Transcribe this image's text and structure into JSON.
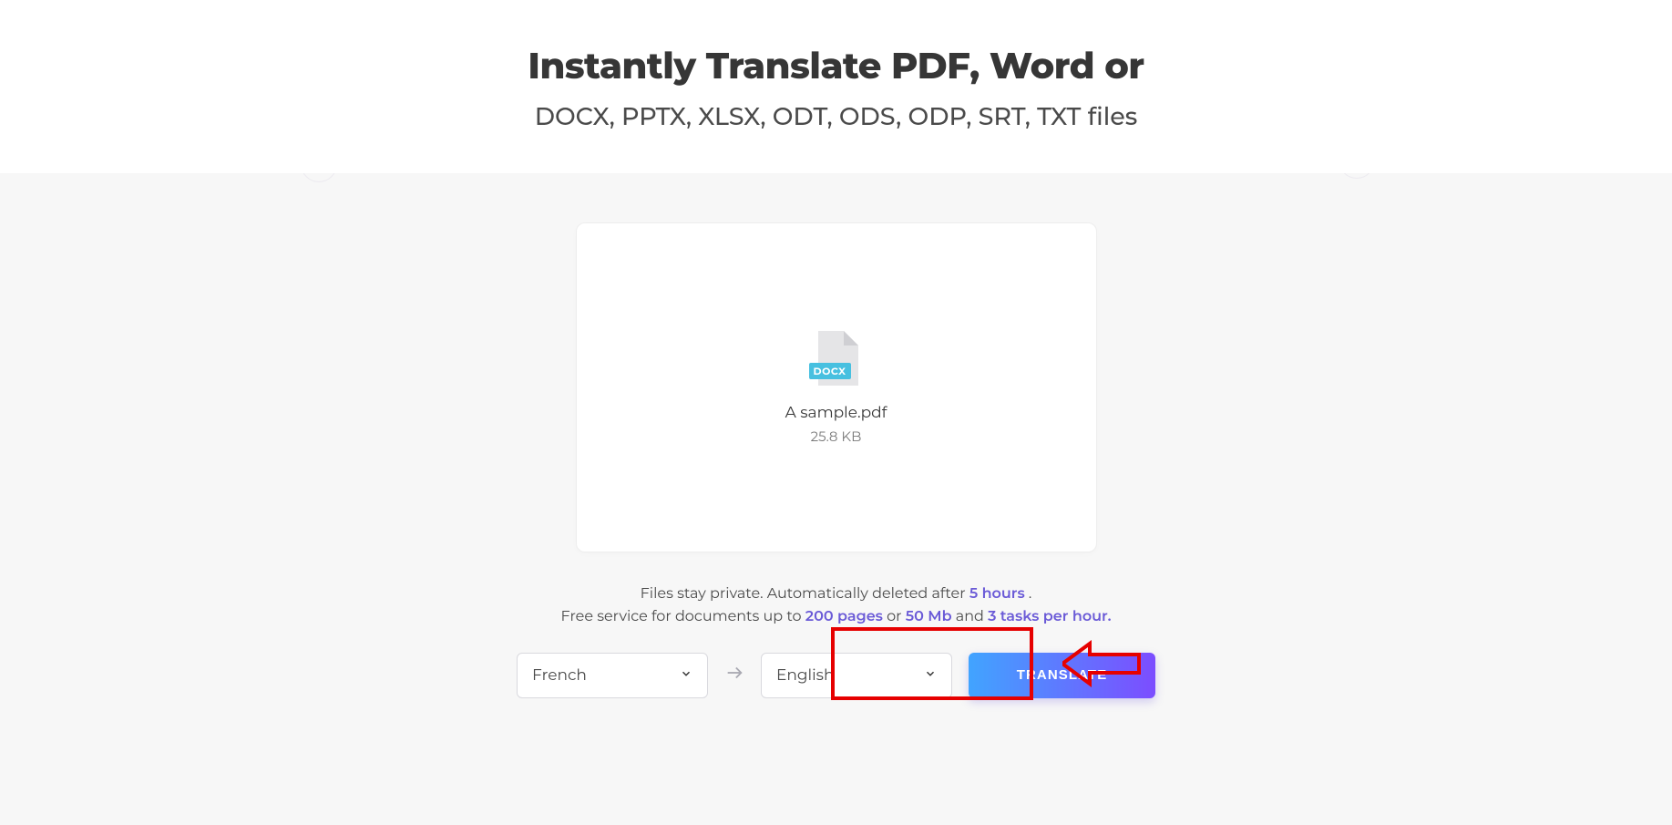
{
  "header": {
    "title_line1": "Instantly Translate PDF, Word or",
    "title_line2": "DOCX, PPTX, XLSX, ODT, ODS, ODP, SRT, TXT files"
  },
  "file": {
    "badge": "DOCX",
    "name": "A sample.pdf",
    "size": "25.8 KB"
  },
  "notice": {
    "l1a": "Files stay private. Automatically deleted after ",
    "l1b": "5 hours",
    "l1c": " .",
    "l2a": "Free service for documents up to ",
    "l2b": "200 pages",
    "l2c": " or ",
    "l2d": "50 Mb",
    "l2e": " and ",
    "l2f": "3 tasks per hour.",
    "l2g": ""
  },
  "controls": {
    "source_lang": "French",
    "target_lang": "English",
    "translate_label": "TRANSLATE"
  },
  "bg_icons": {
    "approx": "≈",
    "quote": "❝",
    "merge": "⅄",
    "cancel": "✖",
    "bookmark": "🔖",
    "puzzle": "🧩",
    "plus": "＋",
    "grid": "⊞",
    "hatch": "◫",
    "ribbon": "▮",
    "cloud": "☁",
    "add": "＋",
    "tags": "🏷",
    "approx2": "≈",
    "puzzle2": "🧩"
  }
}
